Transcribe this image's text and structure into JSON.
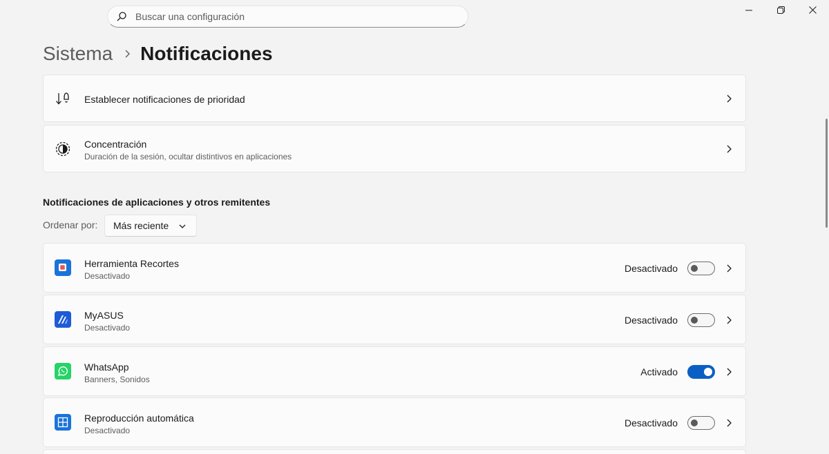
{
  "search": {
    "placeholder": "Buscar una configuración"
  },
  "window_controls": {
    "minimize": "minimize-icon",
    "restore": "restore-icon",
    "close": "close-icon"
  },
  "breadcrumb": {
    "parent": "Sistema",
    "current": "Notificaciones"
  },
  "top_cards": [
    {
      "title": "Establecer notificaciones de prioridad",
      "icon": "priority-notifications-icon"
    },
    {
      "title": "Concentración",
      "subtitle": "Duración de la sesión, ocultar distintivos en aplicaciones",
      "icon": "focus-icon"
    }
  ],
  "apps_section": {
    "title": "Notificaciones de aplicaciones y otros remitentes",
    "sort_label": "Ordenar por:",
    "sort_value": "Más reciente"
  },
  "apps": [
    {
      "name": "Herramienta Recortes",
      "subtitle": "Desactivado",
      "state": "Desactivado",
      "enabled": false,
      "icon": "snipping-tool-icon"
    },
    {
      "name": "MyASUS",
      "subtitle": "Desactivado",
      "state": "Desactivado",
      "enabled": false,
      "icon": "myasus-icon"
    },
    {
      "name": "WhatsApp",
      "subtitle": "Banners, Sonidos",
      "state": "Activado",
      "enabled": true,
      "icon": "whatsapp-icon"
    },
    {
      "name": "Reproducción automática",
      "subtitle": "Desactivado",
      "state": "Desactivado",
      "enabled": false,
      "icon": "autoplay-icon"
    }
  ],
  "colors": {
    "accent": "#0b5fc4",
    "whatsapp": "#25d366",
    "background": "#f3f3f3",
    "card": "#fbfbfb"
  }
}
